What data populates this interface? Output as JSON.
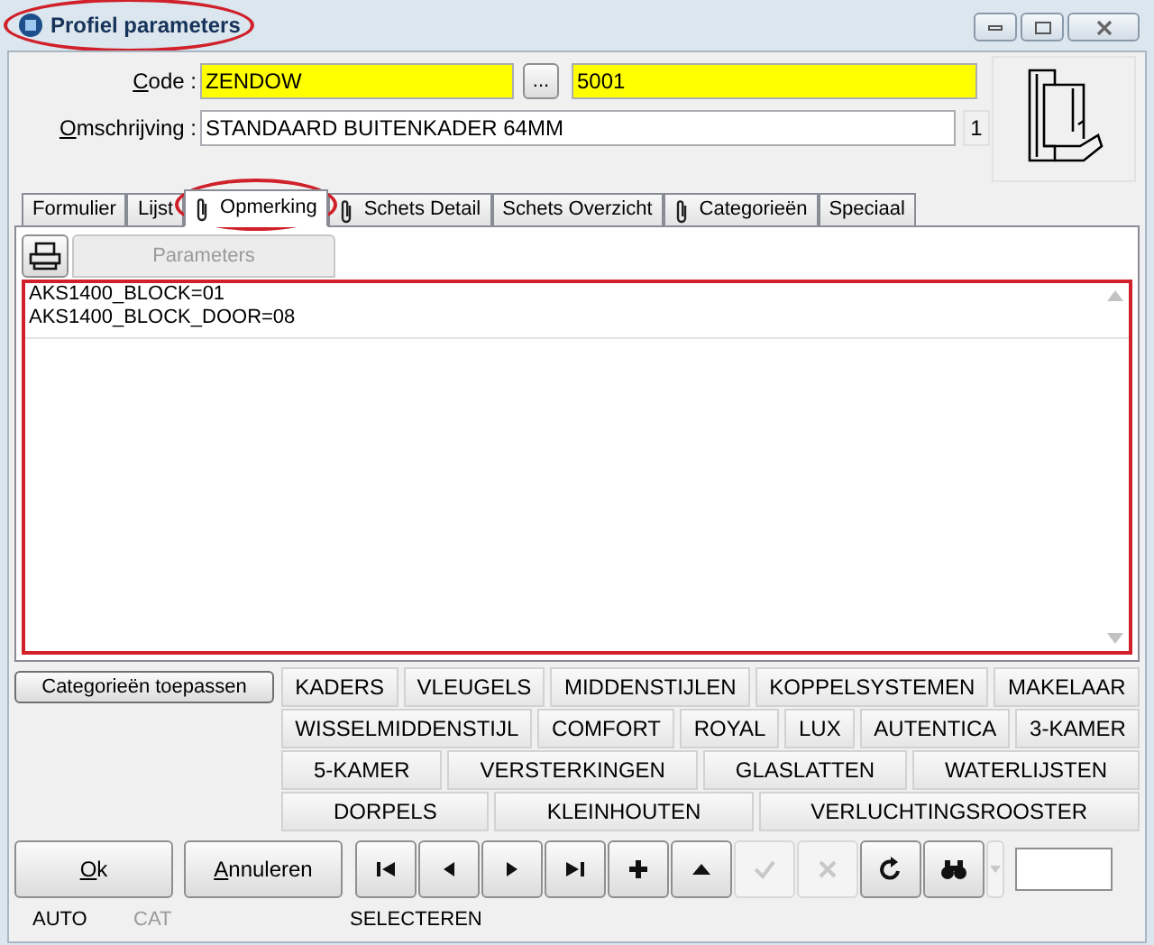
{
  "window": {
    "title": "Profiel parameters"
  },
  "form": {
    "code_label": "Code :",
    "code": "ZENDOW",
    "browse": "...",
    "number": "5001",
    "description_label": "Omschrijving :",
    "description": "STANDAARD BUITENKADER 64MM",
    "count": "1"
  },
  "tabs": [
    {
      "label": "Formulier",
      "selected": false,
      "attachment": false
    },
    {
      "label": "Lijst",
      "selected": false,
      "attachment": false
    },
    {
      "label": "Opmerking",
      "selected": true,
      "attachment": true
    },
    {
      "label": "Schets Detail",
      "selected": false,
      "attachment": true
    },
    {
      "label": "Schets Overzicht",
      "selected": false,
      "attachment": false
    },
    {
      "label": "Categorieën",
      "selected": false,
      "attachment": true
    },
    {
      "label": "Speciaal",
      "selected": false,
      "attachment": false
    }
  ],
  "toolbar": {
    "parameters": {
      "label": "Parameters",
      "disabled": true
    }
  },
  "remarks": [
    "AKS1400_BLOCK=01",
    "AKS1400_BLOCK_DOOR=08"
  ],
  "apply_button": "Categorieën toepassen",
  "categories": [
    [
      "KADERS",
      "VLEUGELS",
      "MIDDENSTIJLEN",
      "KOPPELSYSTEMEN",
      "MAKELAAR"
    ],
    [
      "WISSELMIDDENSTIJL",
      "COMFORT",
      "ROYAL",
      "LUX",
      "AUTENTICA",
      "3-KAMER"
    ],
    [
      "5-KAMER",
      "VERSTERKINGEN",
      "GLASLATTEN",
      "WATERLIJSTEN"
    ],
    [
      "DORPELS",
      "KLEINHOUTEN",
      "VERLUCHTINGSROOSTER"
    ]
  ],
  "buttons": [
    {
      "label": "Ok"
    },
    {
      "label": "Annuleren"
    }
  ],
  "nav_buttons": [
    {
      "kind": "first",
      "disabled": false
    },
    {
      "kind": "prev",
      "disabled": false
    },
    {
      "kind": "next",
      "disabled": false
    },
    {
      "kind": "last",
      "disabled": false
    },
    {
      "kind": "add",
      "disabled": false
    },
    {
      "kind": "up",
      "disabled": false
    },
    {
      "kind": "confirm",
      "disabled": true
    },
    {
      "kind": "cancel",
      "disabled": true
    },
    {
      "kind": "refresh",
      "disabled": false
    },
    {
      "kind": "find",
      "disabled": false
    },
    {
      "kind": "dropdown",
      "disabled": true
    }
  ],
  "status_bar": [
    {
      "label": "AUTO",
      "disabled": false
    },
    {
      "label": "CAT",
      "disabled": true
    },
    {
      "label": "SELECTEREN",
      "disabled": false
    }
  ]
}
